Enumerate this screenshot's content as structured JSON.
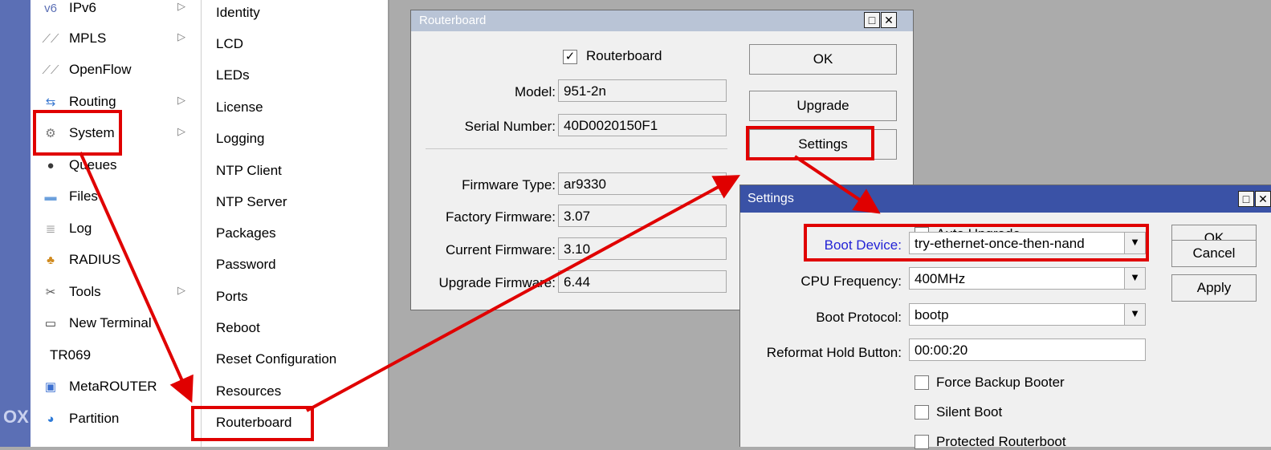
{
  "brand": {
    "text": "OX"
  },
  "main_menu": {
    "items": [
      {
        "label": "IPv6",
        "icon": "ipv6-icon",
        "glyph": "v6",
        "submenu": true
      },
      {
        "label": "MPLS",
        "icon": "mpls-icon",
        "glyph": "⟋⟋",
        "submenu": true
      },
      {
        "label": "OpenFlow",
        "icon": "openflow-icon",
        "glyph": "⟋⟋",
        "submenu": false
      },
      {
        "label": "Routing",
        "icon": "routing-icon",
        "glyph": "⇆",
        "submenu": true
      },
      {
        "label": "System",
        "icon": "gear-icon",
        "glyph": "⚙",
        "submenu": true
      },
      {
        "label": "Queues",
        "icon": "queues-icon",
        "glyph": "●",
        "submenu": false
      },
      {
        "label": "Files",
        "icon": "folder-icon",
        "glyph": "▬",
        "submenu": false
      },
      {
        "label": "Log",
        "icon": "log-icon",
        "glyph": "≣",
        "submenu": false
      },
      {
        "label": "RADIUS",
        "icon": "radius-icon",
        "glyph": "♣",
        "submenu": false
      },
      {
        "label": "Tools",
        "icon": "tools-icon",
        "glyph": "✂",
        "submenu": true
      },
      {
        "label": "New Terminal",
        "icon": "terminal-icon",
        "glyph": "▭",
        "submenu": false
      },
      {
        "label": "TR069",
        "icon": "",
        "glyph": "",
        "submenu": false
      },
      {
        "label": "MetaROUTER",
        "icon": "metarouter-icon",
        "glyph": "▣",
        "submenu": false
      },
      {
        "label": "Partition",
        "icon": "partition-icon",
        "glyph": "◕",
        "submenu": false
      }
    ]
  },
  "sub_menu": {
    "items": [
      "Identity",
      "LCD",
      "LEDs",
      "License",
      "Logging",
      "NTP Client",
      "NTP Server",
      "Packages",
      "Password",
      "Ports",
      "Reboot",
      "Reset Configuration",
      "Resources",
      "Routerboard"
    ]
  },
  "routerboard_window": {
    "title": "Routerboard",
    "routerboard_checkbox_label": "Routerboard",
    "routerboard_checked": true,
    "model_label": "Model:",
    "model_value": "951-2n",
    "serial_label": "Serial Number:",
    "serial_value": "40D0020150F1",
    "firmware_type_label": "Firmware Type:",
    "firmware_type_value": "ar9330",
    "factory_firmware_label": "Factory Firmware:",
    "factory_firmware_value": "3.07",
    "current_firmware_label": "Current Firmware:",
    "current_firmware_value": "3.10",
    "upgrade_firmware_label": "Upgrade Firmware:",
    "upgrade_firmware_value": "6.44",
    "ok_label": "OK",
    "upgrade_label": "Upgrade",
    "settings_label": "Settings"
  },
  "settings_window": {
    "title": "Settings",
    "auto_upgrade_label": "Auto Upgrade",
    "auto_upgrade_checked": false,
    "boot_device_label": "Boot Device:",
    "boot_device_value": "try-ethernet-once-then-nand",
    "cpu_frequency_label": "CPU Frequency:",
    "cpu_frequency_value": "400MHz",
    "boot_protocol_label": "Boot Protocol:",
    "boot_protocol_value": "bootp",
    "reformat_hold_label": "Reformat Hold Button:",
    "reformat_hold_value": "00:00:20",
    "force_backup_label": "Force Backup Booter",
    "silent_boot_label": "Silent Boot",
    "protected_routerboot_label": "Protected Routerboot",
    "ok_label": "OK",
    "cancel_label": "Cancel",
    "apply_label": "Apply"
  },
  "colors": {
    "highlight": "#e00000",
    "active_title": "#3a52a6",
    "inactive_title": "#b9c4d6",
    "link_label": "#2323d6"
  }
}
